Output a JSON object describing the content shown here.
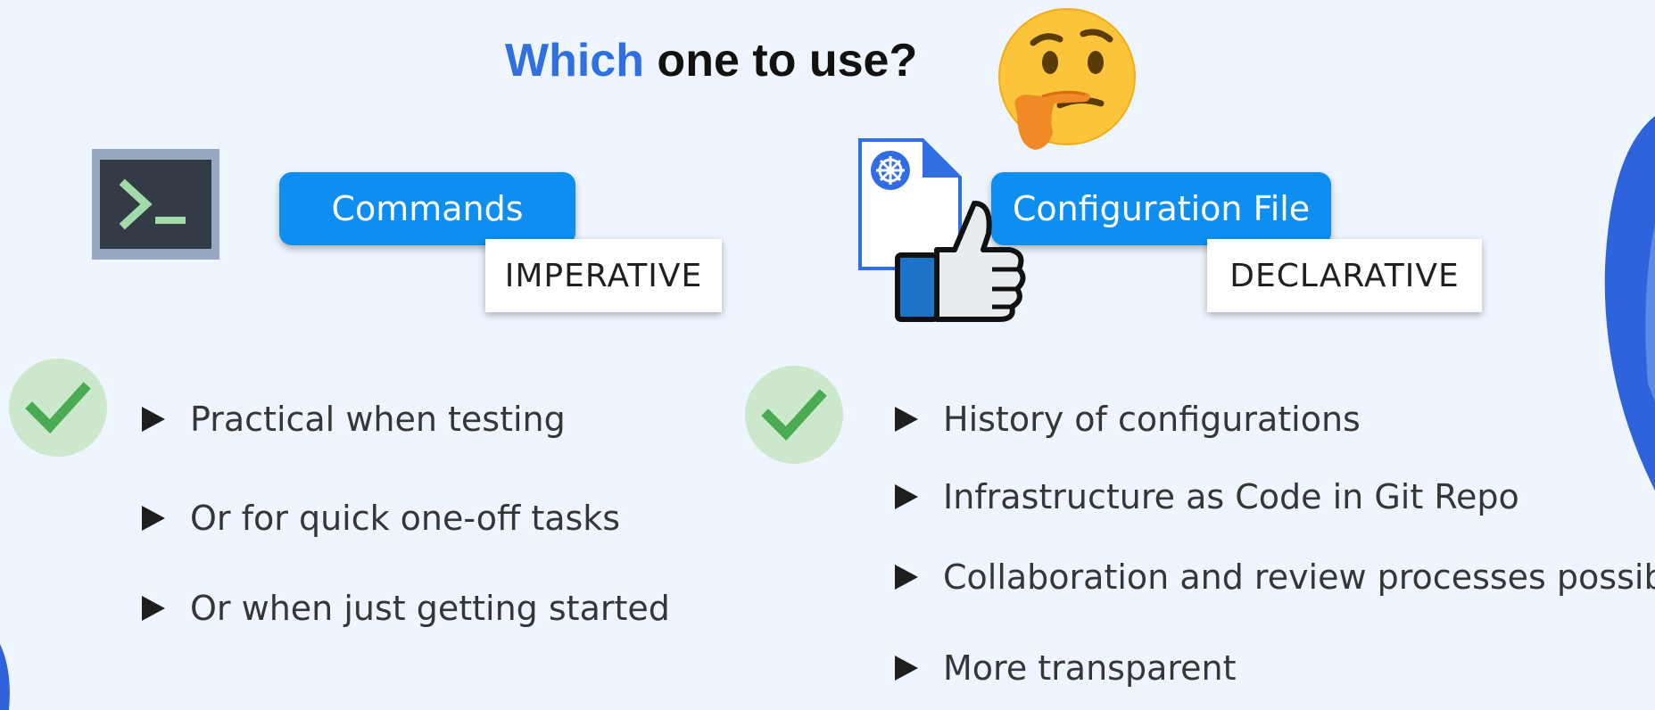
{
  "title": {
    "accent_text": "Which",
    "rest_text": " one to use?"
  },
  "left": {
    "button_label": "Commands",
    "tag_label": "IMPERATIVE",
    "bullets": [
      "Practical when testing",
      "Or for quick one-off tasks",
      "Or when just getting started"
    ]
  },
  "right": {
    "button_label": "Configuration File",
    "tag_label": "DECLARATIVE",
    "bullets": [
      "History of configurations",
      "Infrastructure as Code in Git Repo",
      "Collaboration and review processes possible",
      "More transparent"
    ]
  },
  "icons": {
    "terminal": "terminal-icon",
    "thinking": "thinking-face-icon",
    "kubernetes_file": "kubernetes-file-icon",
    "thumbs_up": "thumbs-up-icon",
    "check": "check-icon",
    "bullet": "triangle-bullet-icon"
  },
  "colors": {
    "background": "#eef5fe",
    "accent_blue": "#2f6fe0",
    "button_blue": "#0d8ef0",
    "check_green": "#4aab53",
    "check_bg": "#cbe8cd"
  }
}
